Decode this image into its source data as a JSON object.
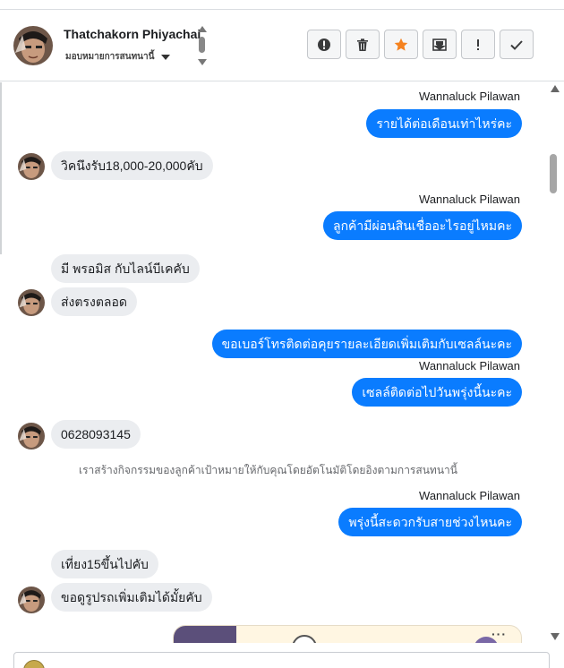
{
  "header": {
    "customer_name": "Thatchakorn Phiyachai",
    "assign_label": "มอบหมายการสนทนานี้",
    "actions": [
      {
        "name": "report-spam-button",
        "icon": "alert-circle-icon"
      },
      {
        "name": "delete-button",
        "icon": "trash-icon"
      },
      {
        "name": "star-button",
        "icon": "star-icon"
      },
      {
        "name": "mark-unread-button",
        "icon": "envelope-icon"
      },
      {
        "name": "mark-important-button",
        "icon": "exclamation-icon"
      },
      {
        "name": "mark-done-button",
        "icon": "checkmark-icon"
      }
    ],
    "star_color": "#f5821f"
  },
  "colors": {
    "outgoing_bubble": "#0a7cff",
    "incoming_bubble": "#ebedf0"
  },
  "messages": {
    "m1_sender": "Wannaluck Pilawan",
    "m1_text": "รายได้ต่อเดือนเท่าไหร่คะ",
    "m2_text": "วิคนึงรับ18,000-20,000คับ",
    "m3_sender": "Wannaluck Pilawan",
    "m3_text": "ลูกค้ามีผ่อนสินเชื่ออะไรอยู่ไหมคะ",
    "m4_text": "มี พรอมิส กับไลน์บีเคคับ",
    "m5_text": "ส่งตรงตลอด",
    "m6_text": "ขอเบอร์โทรติดต่อคุยรายละเอียดเพิ่มเติมกับเซลล์นะคะ",
    "m7_sender": "Wannaluck Pilawan",
    "m7_text": "เซลล์ติดต่อไปวันพรุ่งนี้นะคะ",
    "m8_text": "0628093145",
    "system_note": "เราสร้างกิจกรรมของลูกค้าเป้าหมายให้กับคุณโดยอัตโนมัติโดยอิงตามการสนทนานี้",
    "m9_sender": "Wannaluck Pilawan",
    "m9_text": "พรุ่งนี้สะดวกรับสายช่วงไหนคะ",
    "m10_text": "เที่ยง15ขึ้นไปคับ",
    "m11_text": "ขอดูรูปรถเพิ่มเติมได้มั้ยคับ"
  }
}
